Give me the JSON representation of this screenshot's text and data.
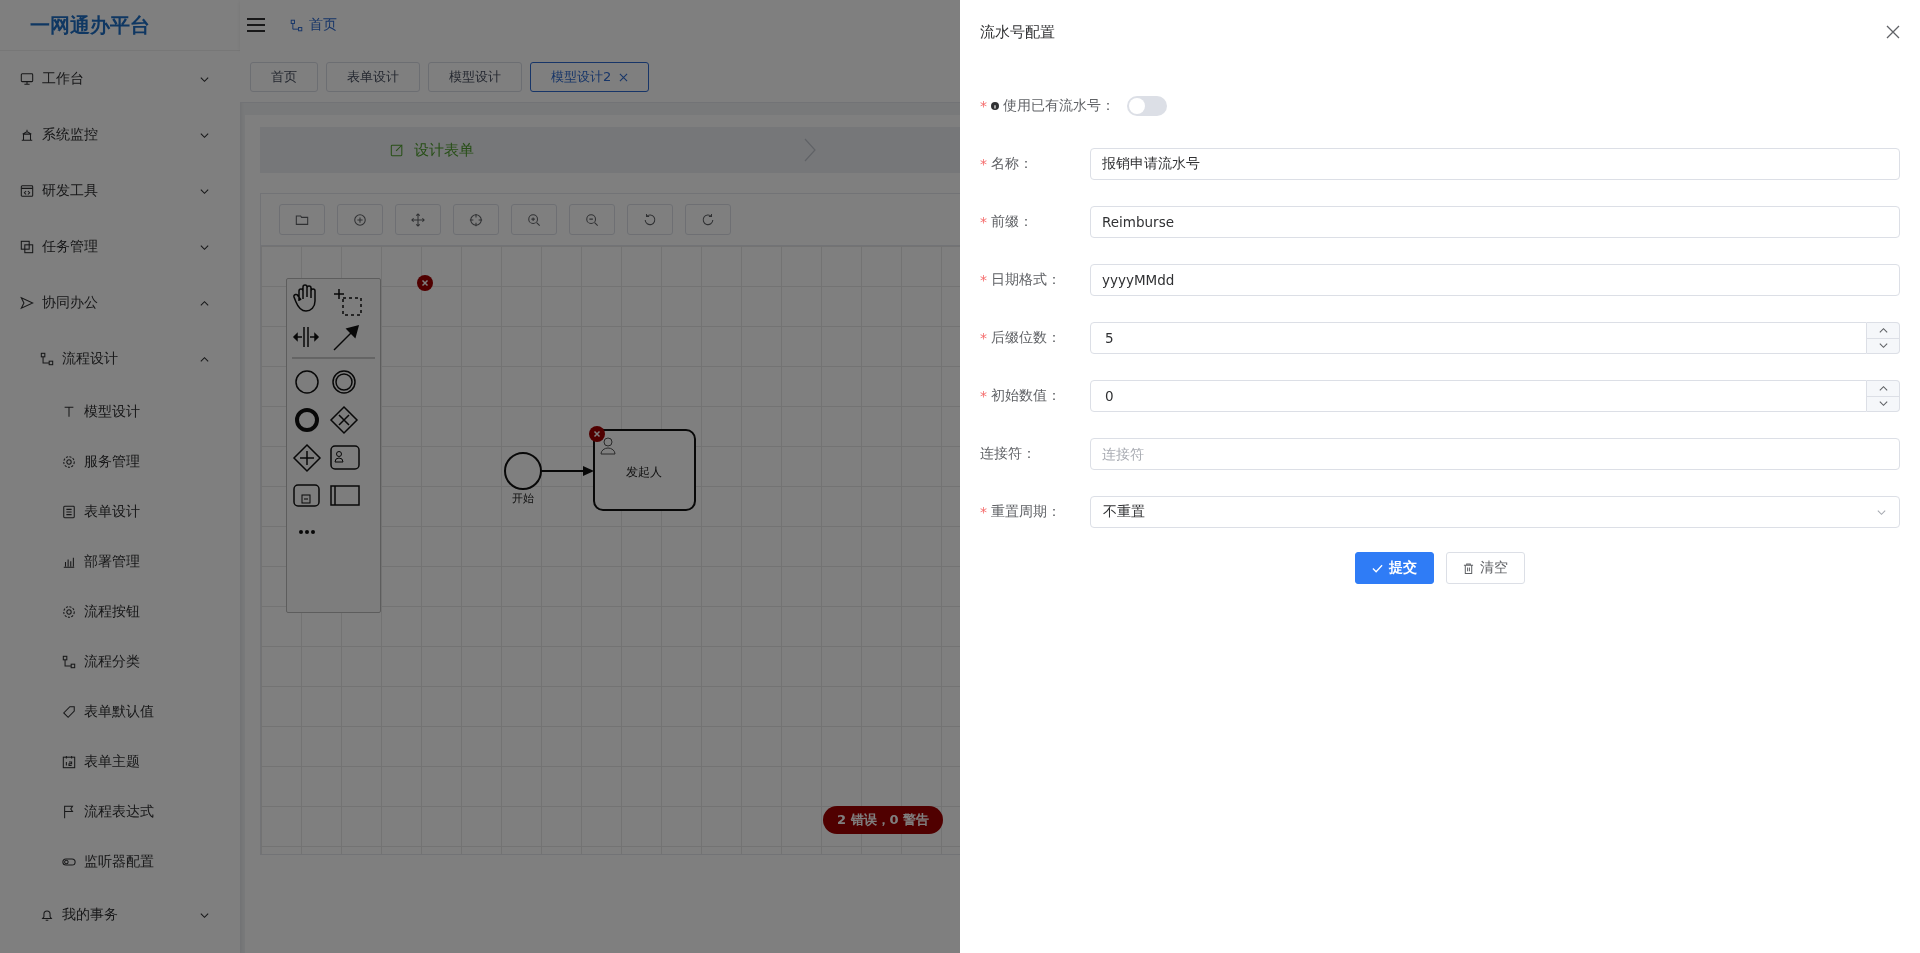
{
  "sidebar": {
    "brand": "一网通办平台",
    "items": [
      {
        "label": "工作台",
        "expanded": false
      },
      {
        "label": "系统监控",
        "expanded": false
      },
      {
        "label": "研发工具",
        "expanded": false
      },
      {
        "label": "任务管理",
        "expanded": false
      },
      {
        "label": "协同办公",
        "expanded": true,
        "children": [
          {
            "label": "流程设计",
            "expanded": true,
            "children": [
              {
                "label": "模型设计"
              },
              {
                "label": "服务管理"
              },
              {
                "label": "表单设计"
              },
              {
                "label": "部署管理"
              },
              {
                "label": "流程按钮"
              },
              {
                "label": "流程分类"
              },
              {
                "label": "表单默认值"
              },
              {
                "label": "表单主题"
              },
              {
                "label": "流程表达式"
              },
              {
                "label": "监听器配置"
              }
            ]
          },
          {
            "label": "我的事务",
            "expanded": false
          }
        ]
      }
    ]
  },
  "header": {
    "breadcrumb": "首页"
  },
  "tabs": [
    {
      "label": "首页",
      "selected": false
    },
    {
      "label": "表单设计",
      "selected": false
    },
    {
      "label": "模型设计",
      "selected": false
    },
    {
      "label": "模型设计2",
      "selected": true
    }
  ],
  "steps": [
    {
      "label": "设计表单",
      "selected": true
    }
  ],
  "diagram": {
    "start_label": "开始",
    "task_label": "发起人",
    "status": "2 错误，0 警告"
  },
  "drawer": {
    "title": "流水号配置",
    "fields": [
      {
        "kind": "switch",
        "label": "使用已有流水号：",
        "required_mark": "*",
        "info": true,
        "on": false
      },
      {
        "kind": "text",
        "label": "名称：",
        "required_mark": "*",
        "value": "报销申请流水号"
      },
      {
        "kind": "text",
        "label": "前缀：",
        "required_mark": "*",
        "value": "Reimburse"
      },
      {
        "kind": "text",
        "label": "日期格式：",
        "required_mark": "*",
        "value": "yyyyMMdd"
      },
      {
        "kind": "number",
        "label": "后缀位数：",
        "required_mark": "*",
        "value": "5"
      },
      {
        "kind": "number",
        "label": "初始数值：",
        "required_mark": "*",
        "value": "0"
      },
      {
        "kind": "text",
        "label": "连接符：",
        "placeholder": "连接符"
      },
      {
        "kind": "select",
        "label": "重置周期：",
        "required_mark": "*",
        "value": "不重置"
      }
    ],
    "buttons": [
      {
        "label": "提交",
        "kind": "primary"
      },
      {
        "label": "清空",
        "kind": "default"
      }
    ]
  }
}
